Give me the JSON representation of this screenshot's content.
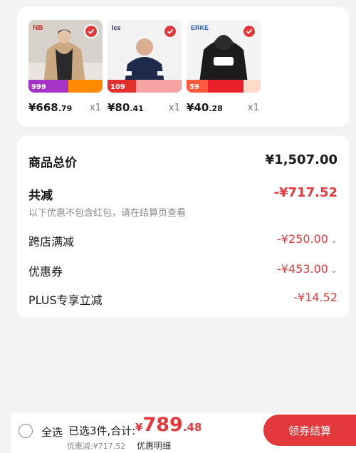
{
  "products": [
    {
      "price_int": "¥668",
      "price_dec": ".79",
      "qty": "x1",
      "thumb_label": "999",
      "icon": "down-jacket-photo"
    },
    {
      "price_int": "¥80",
      "price_dec": ".41",
      "qty": "x1",
      "thumb_label": "109",
      "icon": "tshirt-model-photo"
    },
    {
      "price_int": "¥40",
      "price_dec": ".28",
      "qty": "x1",
      "thumb_label": "59",
      "icon": "hoodie-photo"
    }
  ],
  "summary": {
    "goods_total_label": "商品总价",
    "goods_total_value": "¥1,507.00",
    "total_discount_label": "共减",
    "total_discount_value": "-¥717.52",
    "note": "以下优惠不包含红包，请在结算页查看",
    "cross_store_label": "跨店满减",
    "cross_store_value": "-¥250.00",
    "coupon_label": "优惠券",
    "coupon_value": "-¥453.00",
    "plus_label": "PLUS专享立减",
    "plus_value": "-¥14.52"
  },
  "bottom_bar": {
    "select_all": "全选",
    "selected_prefix": "已选3件,合计:",
    "sum_currency": "¥",
    "sum_int": "789",
    "sum_dec": ".48",
    "discount_text": "优惠减:¥717.52",
    "detail_link": "优惠明细",
    "checkout_label": "领券结算"
  },
  "colors": {
    "accent": "#e4393c",
    "checkout": "#e4393c"
  }
}
